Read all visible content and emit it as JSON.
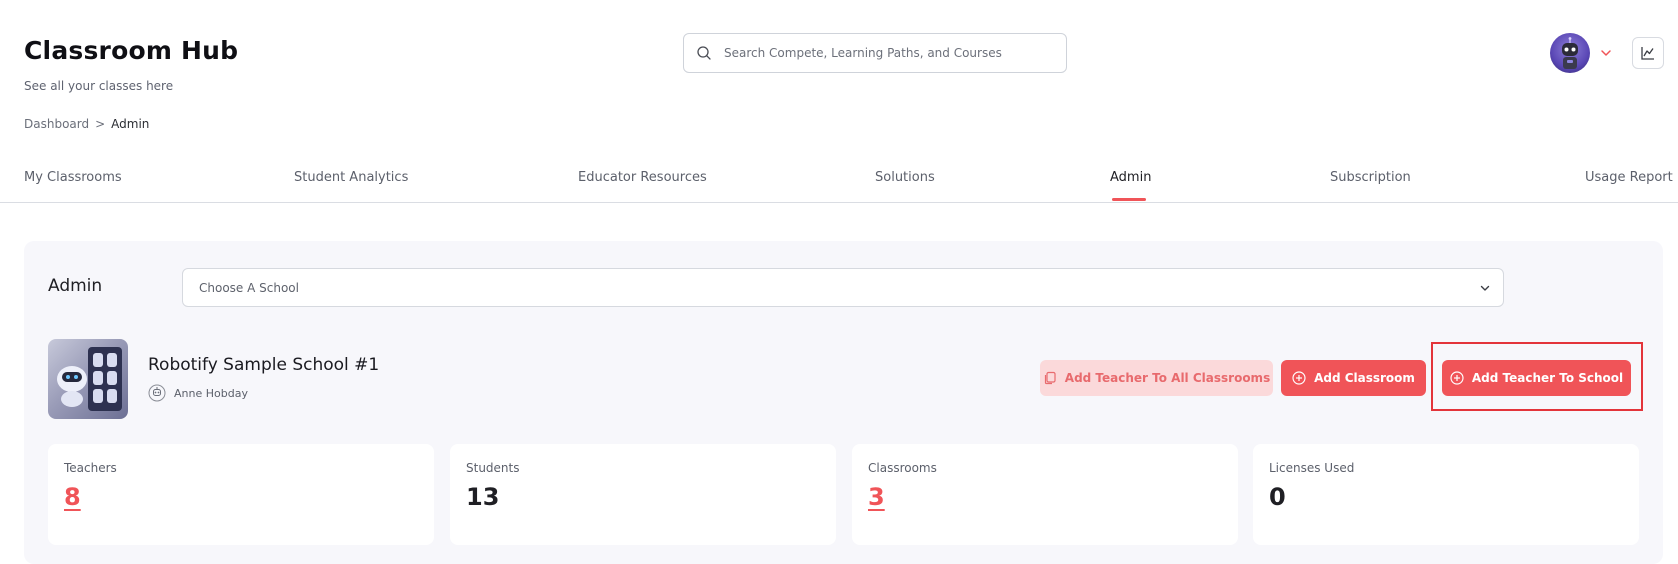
{
  "header": {
    "title": "Classroom Hub",
    "subtitle": "See all your classes here"
  },
  "breadcrumb": {
    "root": "Dashboard",
    "separator": ">",
    "current": "Admin"
  },
  "search": {
    "placeholder": "Search Compete, Learning Paths, and Courses"
  },
  "tabs": [
    {
      "label": "My Classrooms",
      "active": false
    },
    {
      "label": "Student Analytics",
      "active": false
    },
    {
      "label": "Educator Resources",
      "active": false
    },
    {
      "label": "Solutions",
      "active": false
    },
    {
      "label": "Admin",
      "active": true
    },
    {
      "label": "Subscription",
      "active": false
    },
    {
      "label": "Usage Report",
      "active": false
    }
  ],
  "admin": {
    "title": "Admin",
    "school_select_placeholder": "Choose A School"
  },
  "school": {
    "name": "Robotify Sample School #1",
    "owner": "Anne Hobday"
  },
  "actions": {
    "add_teacher_all": "Add Teacher To All Classrooms",
    "add_classroom": "Add Classroom",
    "add_teacher_school": "Add Teacher To School"
  },
  "stats": [
    {
      "label": "Teachers",
      "value": "8",
      "link": true
    },
    {
      "label": "Students",
      "value": "13",
      "link": false
    },
    {
      "label": "Classrooms",
      "value": "3",
      "link": true
    },
    {
      "label": "Licenses Used",
      "value": "0",
      "link": false
    }
  ],
  "colors": {
    "accent": "#f05458",
    "accent_soft": "#fbd9da",
    "panel_bg": "#f7f7fb"
  }
}
